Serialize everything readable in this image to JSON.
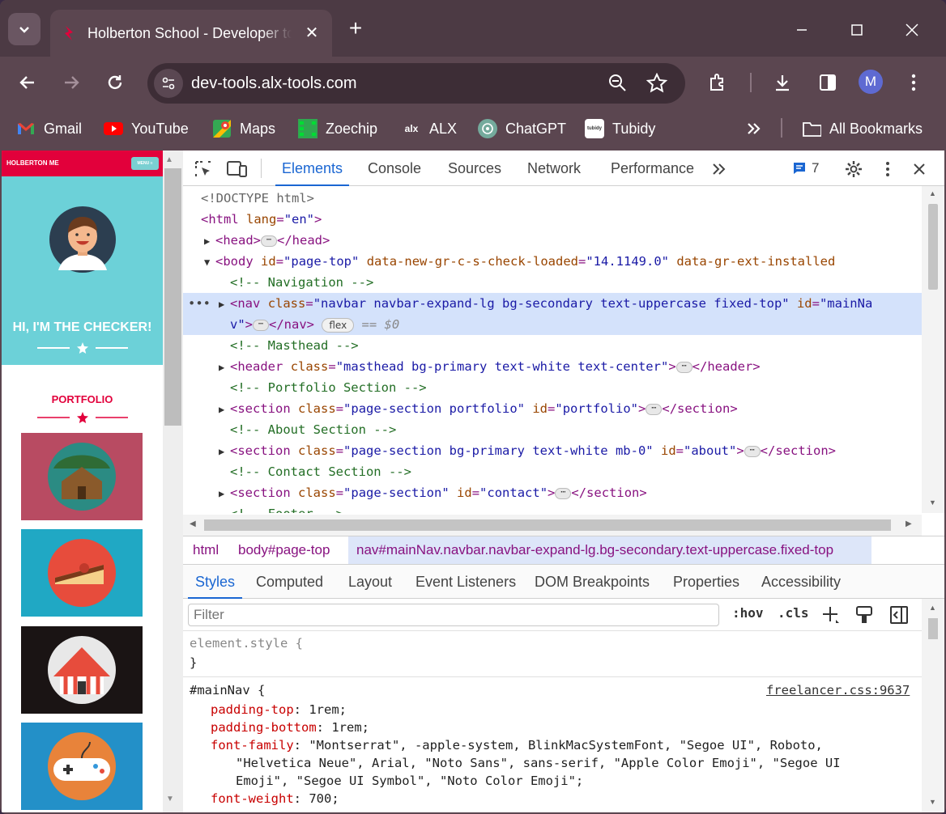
{
  "browser": {
    "tab_title": "Holberton School - Developer tools",
    "url": "dev-tools.alx-tools.com",
    "profile_initial": "M",
    "bookmarks": [
      {
        "label": "Gmail",
        "icon": "gmail-icon"
      },
      {
        "label": "YouTube",
        "icon": "youtube-icon"
      },
      {
        "label": "Maps",
        "icon": "maps-icon"
      },
      {
        "label": "Zoechip",
        "icon": "zoechip-icon"
      },
      {
        "label": "ALX",
        "icon": "alx-icon",
        "icon_text": "alx"
      },
      {
        "label": "ChatGPT",
        "icon": "chatgpt-icon"
      },
      {
        "label": "Tubidy",
        "icon": "tubidy-icon",
        "icon_text": "tubidy"
      }
    ],
    "all_bookmarks": "All Bookmarks"
  },
  "preview": {
    "brand": "HOLBERTON ME",
    "menu": "MENU ≡",
    "greeting": "HI, I'M THE CHECKER!",
    "portfolio": "PORTFOLIO",
    "tile_colors": [
      "#b84b62",
      "#20a8c4",
      "#1a1414",
      "#2390c8"
    ]
  },
  "devtools": {
    "tabs": [
      "Elements",
      "Console",
      "Sources",
      "Network",
      "Performance"
    ],
    "active_tab": "Elements",
    "issues_count": "7",
    "tree": {
      "doctype": "<!DOCTYPE html>",
      "html_open": {
        "tag": "html",
        "attr": "lang",
        "val": "\"en\""
      },
      "head": {
        "open": "<head>",
        "close": "</head>"
      },
      "body": {
        "tag": "body",
        "a1": "id",
        "v1": "\"page-top\"",
        "a2": "data-new-gr-c-s-check-loaded",
        "v2": "\"14.1149.0\"",
        "a3": "data-gr-ext-installed"
      },
      "c_nav": "<!-- Navigation -->",
      "nav": {
        "tag": "nav",
        "a1": "class",
        "v1": "\"navbar navbar-expand-lg bg-secondary text-uppercase fixed-top\"",
        "a2": "id",
        "v2a": "\"mainNa",
        "v2b": "v\"",
        "close": "</nav>",
        "badge": "flex",
        "eq": "== $0"
      },
      "c_mast": "<!-- Masthead -->",
      "header": {
        "tag": "header",
        "a1": "class",
        "v1": "\"masthead bg-primary text-white text-center\"",
        "close": "</header>"
      },
      "c_port": "<!-- Portfolio Section -->",
      "sec1": {
        "tag": "section",
        "a1": "class",
        "v1": "\"page-section portfolio\"",
        "a2": "id",
        "v2": "\"portfolio\"",
        "close": "</section>"
      },
      "c_about": "<!-- About Section -->",
      "sec2": {
        "tag": "section",
        "a1": "class",
        "v1": "\"page-section bg-primary text-white mb-0\"",
        "a2": "id",
        "v2": "\"about\"",
        "close": "</section>"
      },
      "c_contact": "<!-- Contact Section -->",
      "sec3": {
        "tag": "section",
        "a1": "class",
        "v1": "\"page-section\"",
        "a2": "id",
        "v2": "\"contact\"",
        "close": "</section>"
      },
      "c_footer": "<!-- Footer -->"
    },
    "breadcrumbs": [
      "html",
      "body#page-top",
      "nav#mainNav.navbar.navbar-expand-lg.bg-secondary.text-uppercase.fixed-top"
    ],
    "sub_tabs": [
      "Styles",
      "Computed",
      "Layout",
      "Event Listeners",
      "DOM Breakpoints",
      "Properties",
      "Accessibility"
    ],
    "filter_placeholder": "Filter",
    "hov": ":hov",
    "cls": ".cls",
    "styles": {
      "element_style": "element.style {",
      "close_brace": "}",
      "rule_selector": "#mainNav {",
      "rule_source": "freelancer.css:9637",
      "props": [
        {
          "name": "padding-top",
          "value": "1rem;"
        },
        {
          "name": "padding-bottom",
          "value": "1rem;"
        },
        {
          "name": "font-family",
          "value": "\"Montserrat\", -apple-system, BlinkMacSystemFont, \"Segoe UI\", Roboto,"
        },
        {
          "name": "font-weight",
          "value": "700;"
        }
      ],
      "font_cont1": "\"Helvetica Neue\", Arial, \"Noto Sans\", sans-serif, \"Apple Color Emoji\", \"Segoe UI",
      "font_cont2": "Emoji\", \"Segoe UI Symbol\", \"Noto Color Emoji\";"
    }
  }
}
